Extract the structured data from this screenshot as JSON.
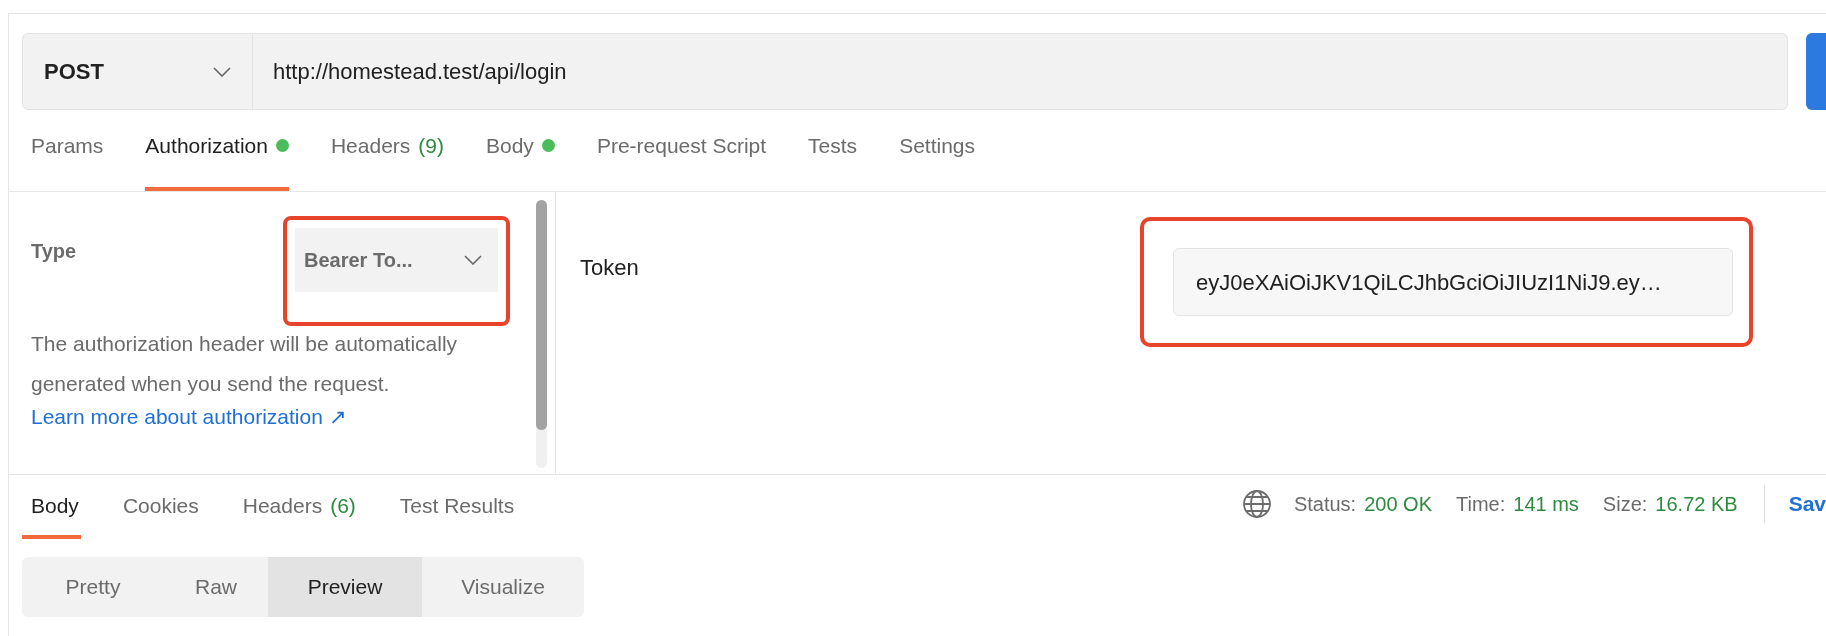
{
  "request": {
    "method": "POST",
    "url": "http://homestead.test/api/login"
  },
  "request_tabs": [
    {
      "label": "Params",
      "selected": false
    },
    {
      "label": "Authorization",
      "selected": true,
      "dot": true
    },
    {
      "label": "Headers",
      "count": "(9)",
      "selected": false
    },
    {
      "label": "Body",
      "selected": false,
      "dot": true
    },
    {
      "label": "Pre-request Script",
      "selected": false
    },
    {
      "label": "Tests",
      "selected": false
    },
    {
      "label": "Settings",
      "selected": false
    }
  ],
  "auth": {
    "type_label": "Type",
    "type_value": "Bearer To...",
    "type_highlighted": true,
    "description": "The authorization header will be automatically generated when you send the request.",
    "link": "Learn more about authorization ↗",
    "token_label": "Token",
    "token_value": "eyJ0eXAiOiJKV1QiLCJhbGciOiJIUzI1NiJ9.ey…",
    "token_highlighted": true
  },
  "response_tabs": [
    {
      "label": "Body",
      "selected": true
    },
    {
      "label": "Cookies",
      "selected": false
    },
    {
      "label": "Headers",
      "count": "(6)",
      "selected": false
    },
    {
      "label": "Test Results",
      "selected": false
    }
  ],
  "view_modes": [
    {
      "label": "Pretty",
      "selected": false
    },
    {
      "label": "Raw",
      "selected": false
    },
    {
      "label": "Preview",
      "selected": true
    },
    {
      "label": "Visualize",
      "selected": false
    }
  ],
  "status": [
    {
      "label": "Status:",
      "value": "200 OK"
    },
    {
      "label": "Time:",
      "value": "141 ms"
    },
    {
      "label": "Size:",
      "value": "16.72 KB"
    }
  ],
  "save_button": "Sav"
}
